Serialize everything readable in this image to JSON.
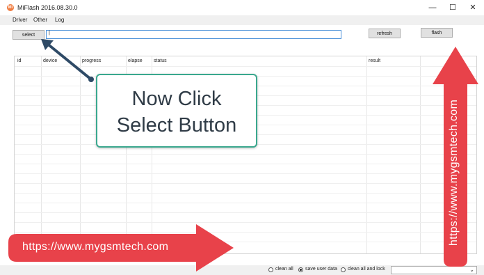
{
  "window": {
    "title": "MiFlash 2016.08.30.0",
    "icon_text": "Mi",
    "minimize": "—",
    "maximize": "☐",
    "close": "✕"
  },
  "menu": [
    "Driver",
    "Other",
    "Log"
  ],
  "toolbar": {
    "select_label": "select",
    "path_value": "|",
    "refresh_label": "refresh",
    "flash_label": "flash"
  },
  "table": {
    "columns": [
      "id",
      "device",
      "progress",
      "elapse",
      "status",
      "result"
    ]
  },
  "bottom": {
    "options": [
      {
        "label": "clean all",
        "selected": false
      },
      {
        "label": "save user data",
        "selected": true
      },
      {
        "label": "clean all and lock",
        "selected": false
      }
    ],
    "dropdown_arrow": "⌄"
  },
  "annotations": {
    "callout_line1": "Now Click",
    "callout_line2": "Select Button",
    "watermark_horizontal": "https://www.mygsmtech.com",
    "watermark_vertical": "https://www.mygsmtech.com",
    "red_color": "#e8424a",
    "accent_color": "#3aa88e",
    "arrow_color": "#2e4a66"
  }
}
